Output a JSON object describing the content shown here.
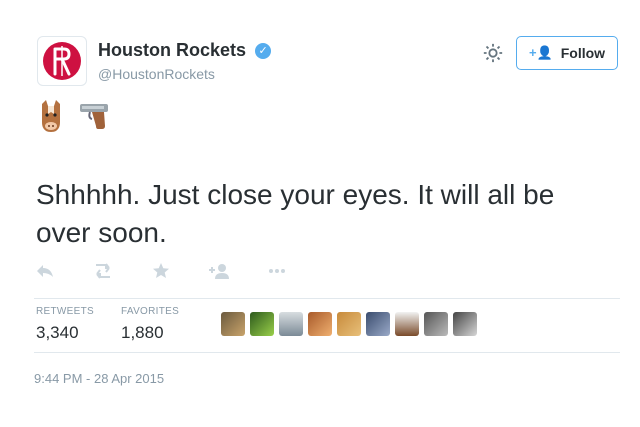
{
  "tweet": {
    "display_name": "Houston Rockets",
    "handle": "@HoustonRockets",
    "follow_label": "Follow",
    "text": "Shhhhh. Just close your eyes. It will all be over soon.",
    "timestamp": "9:44 PM - 28 Apr 2015",
    "emojis": [
      "horse-face-emoji",
      "pistol-emoji"
    ]
  },
  "stats": {
    "retweets_label": "RETWEETS",
    "retweets_value": "3,340",
    "favorites_label": "FAVORITES",
    "favorites_value": "1,880"
  },
  "actions": [
    "reply-icon",
    "retweet-icon",
    "favorite-icon",
    "follow-icon",
    "more-icon"
  ],
  "colors": {
    "brand_blue": "#55acee",
    "text": "#292f33",
    "muted": "#8899a6",
    "rockets_red": "#ce1141"
  }
}
